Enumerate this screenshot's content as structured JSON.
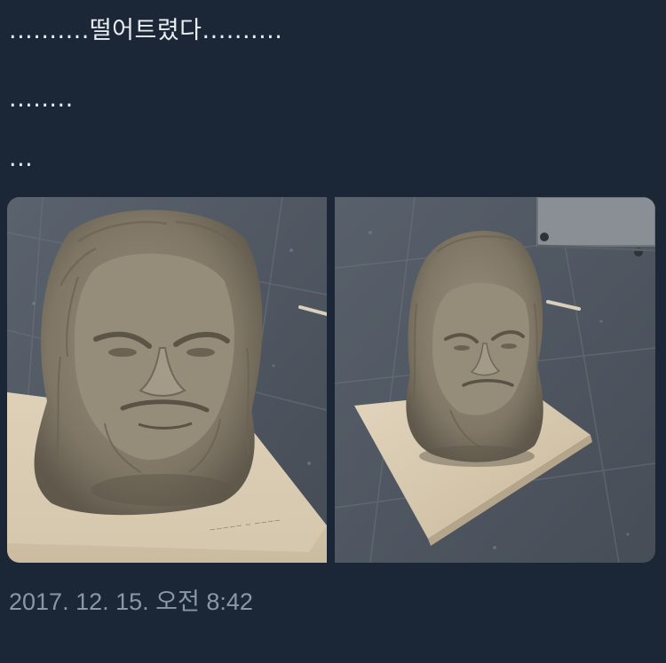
{
  "tweet": {
    "lines": [
      "..........떨어트렸다..........",
      "........",
      "..."
    ],
    "timestamp": "2017. 12. 15. 오전 8:42"
  },
  "colors": {
    "background": "#1b2637",
    "text": "#e8edf1",
    "timestamp": "#8899a6",
    "floor": "#4d5560",
    "clay": "#8b8270",
    "board": "#d8c9b0"
  }
}
